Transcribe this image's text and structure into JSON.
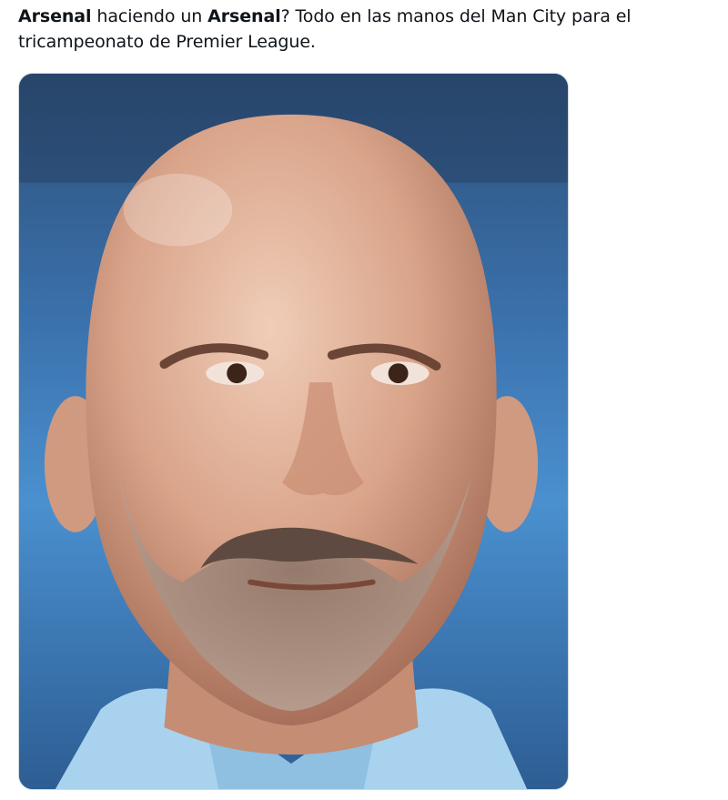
{
  "tweet": {
    "text_parts": [
      {
        "text": "Arsenal",
        "bold": true
      },
      {
        "text": " haciendo un ",
        "bold": false
      },
      {
        "text": "Arsenal",
        "bold": true
      },
      {
        "text": "? Todo en las manos del Man City para el tricampeonato de Premier League.",
        "bold": false
      }
    ]
  },
  "media": {
    "icon": "photo-portrait",
    "colors": {
      "background_blue": "#3a78b8",
      "skin": "#d9a98f",
      "shirt": "#9ecbea"
    }
  }
}
